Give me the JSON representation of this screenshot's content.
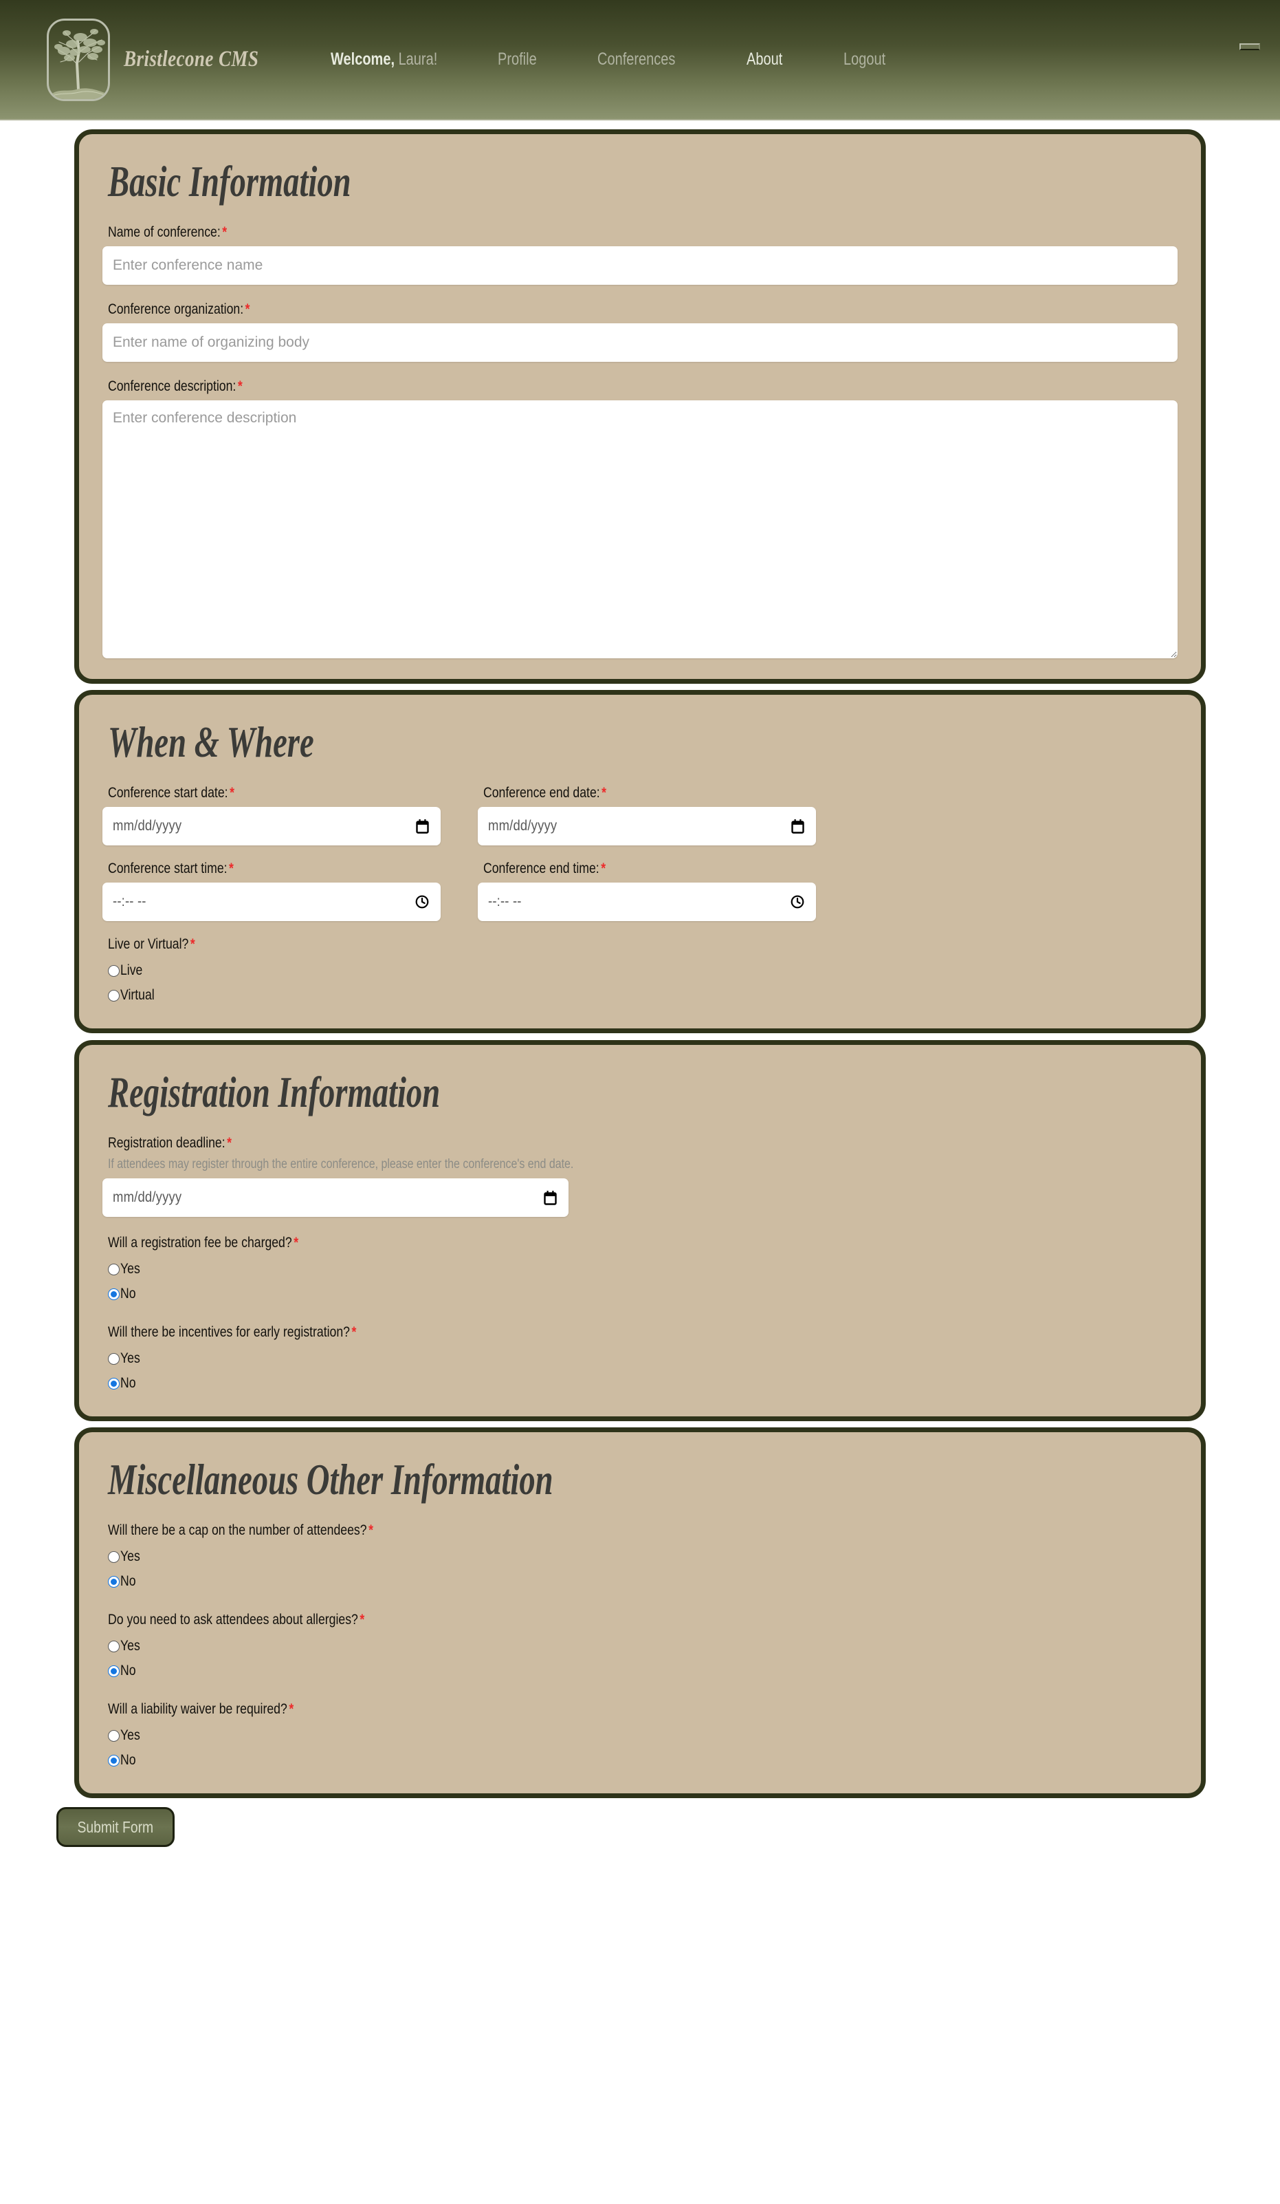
{
  "header": {
    "brand": "Bristlecone CMS",
    "welcome_prefix": "Welcome,",
    "user_name": "Laura!",
    "nav": [
      {
        "label": "Profile",
        "active": false
      },
      {
        "label": "Conferences",
        "active": false
      },
      {
        "label": "About",
        "active": true
      },
      {
        "label": "Logout",
        "active": false
      }
    ],
    "colors": {
      "gradient_top": "#333a1e",
      "gradient_bottom": "#8c9470",
      "brand_text": "#cfc9b4",
      "nav_text": "#b0b3a0",
      "nav_active_text": "#e8ebdf"
    }
  },
  "theme": {
    "card_bg": "#cdbca2",
    "card_border": "#2e3319",
    "required_marker": "#ec2b2b",
    "radio_checked": "#1576e0",
    "heading_text": "#3b3b38"
  },
  "sections": {
    "basic": {
      "title": "Basic Information",
      "name_label": "Name of conference:",
      "name_placeholder": "Enter conference name",
      "name_value": "",
      "org_label": "Conference organization:",
      "org_placeholder": "Enter name of organizing body",
      "org_value": "",
      "desc_label": "Conference description:",
      "desc_placeholder": "Enter conference description",
      "desc_value": ""
    },
    "when": {
      "title": "When & Where",
      "start_date_label": "Conference start date:",
      "start_date_placeholder": "mm/dd/yyyy",
      "end_date_label": "Conference end date:",
      "end_date_placeholder": "mm/dd/yyyy",
      "start_time_label": "Conference start time:",
      "start_time_placeholder": "--:-- --",
      "end_time_label": "Conference end time:",
      "end_time_placeholder": "--:-- --",
      "mode_label": "Live or Virtual?",
      "mode_options": [
        {
          "label": "Live",
          "checked": false
        },
        {
          "label": "Virtual",
          "checked": false
        }
      ]
    },
    "registration": {
      "title": "Registration Information",
      "deadline_label": "Registration deadline:",
      "deadline_helper": "If attendees may register through the entire conference, please enter the conference's end date.",
      "deadline_placeholder": "mm/dd/yyyy",
      "questions": [
        {
          "label": "Will a registration fee be charged?",
          "options": [
            {
              "label": "Yes",
              "checked": false
            },
            {
              "label": "No",
              "checked": true
            }
          ]
        },
        {
          "label": "Will there be incentives for early registration?",
          "options": [
            {
              "label": "Yes",
              "checked": false
            },
            {
              "label": "No",
              "checked": true
            }
          ]
        }
      ]
    },
    "misc": {
      "title": "Miscellaneous Other Information",
      "questions": [
        {
          "label": "Will there be a cap on the number of attendees?",
          "options": [
            {
              "label": "Yes",
              "checked": false
            },
            {
              "label": "No",
              "checked": true
            }
          ]
        },
        {
          "label": "Do you need to ask attendees about allergies?",
          "options": [
            {
              "label": "Yes",
              "checked": false
            },
            {
              "label": "No",
              "checked": true
            }
          ]
        },
        {
          "label": "Will a liability waiver be required?",
          "options": [
            {
              "label": "Yes",
              "checked": false
            },
            {
              "label": "No",
              "checked": true
            }
          ]
        }
      ]
    }
  },
  "footer": {
    "submit_label": "Submit Form"
  },
  "required_marker": "*"
}
